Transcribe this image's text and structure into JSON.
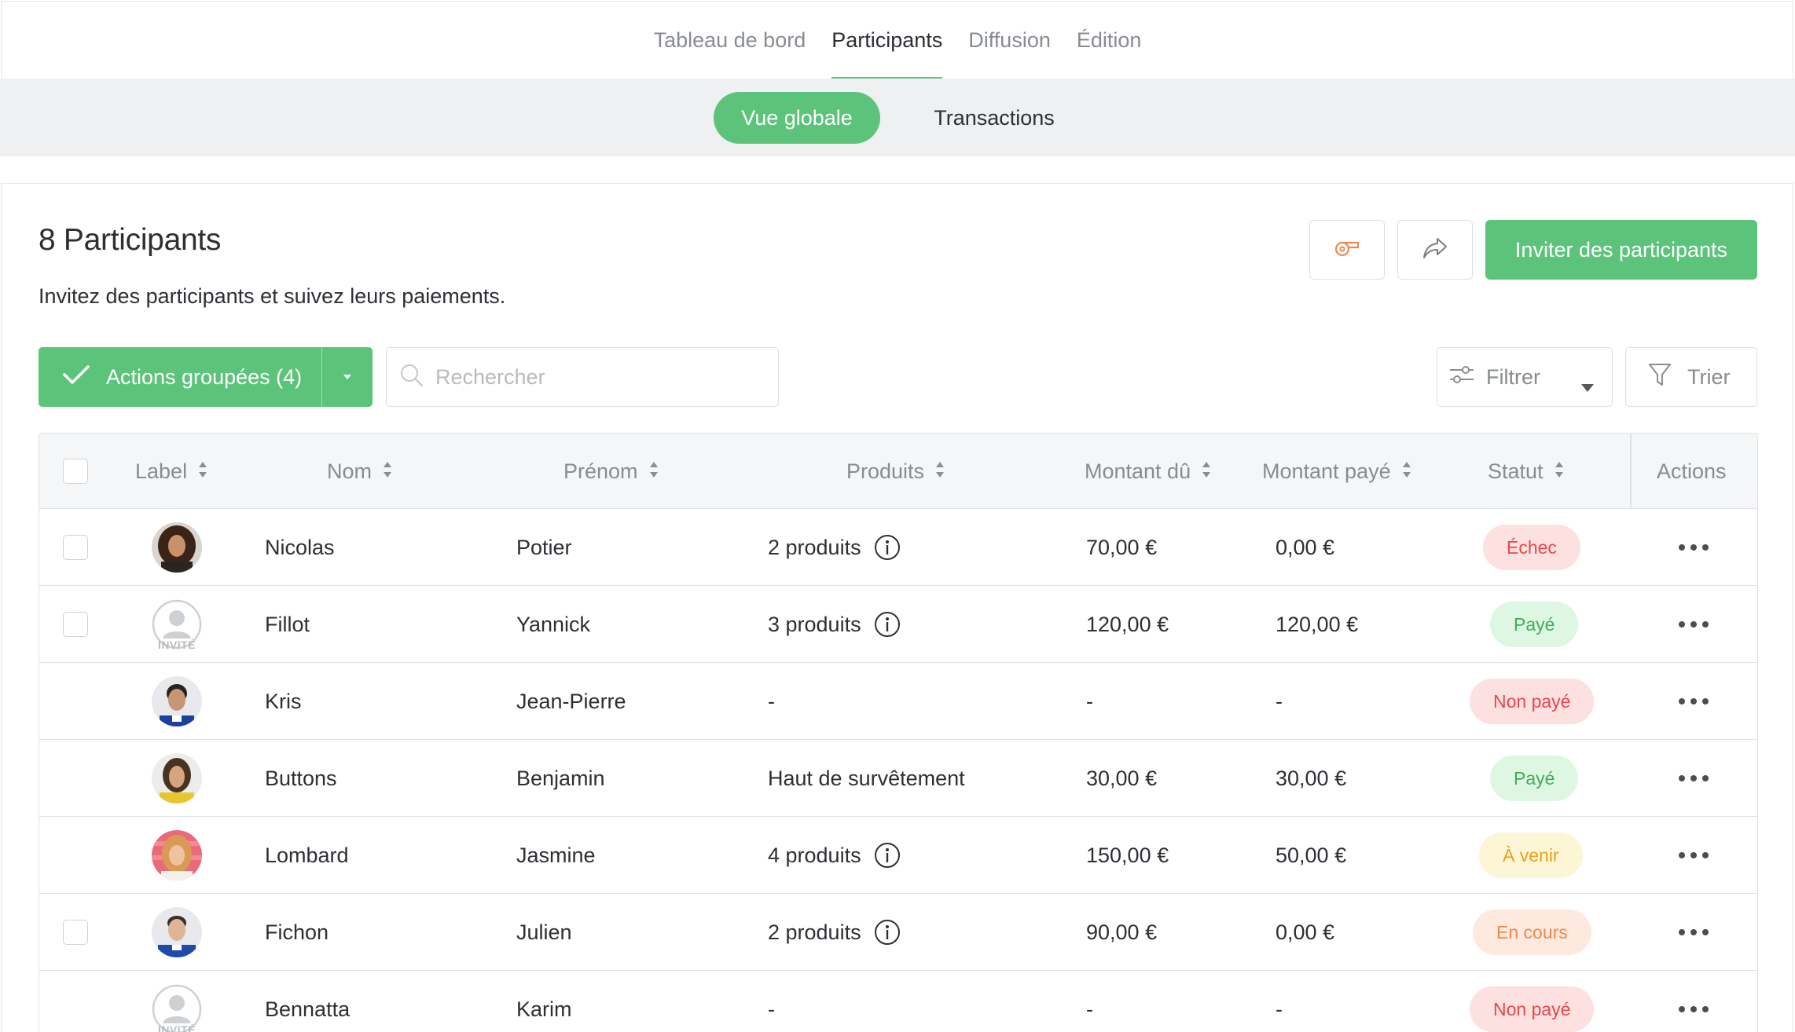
{
  "topnav": {
    "tabs": [
      {
        "label": "Tableau de bord",
        "active": false
      },
      {
        "label": "Participants",
        "active": true
      },
      {
        "label": "Diffusion",
        "active": false
      },
      {
        "label": "Édition",
        "active": false
      }
    ]
  },
  "subnav": {
    "pills": [
      {
        "label": "Vue globale",
        "active": true
      },
      {
        "label": "Transactions",
        "active": false
      }
    ]
  },
  "header": {
    "title": "8 Participants",
    "subtitle": "Invitez des participants et suivez leurs paiements.",
    "whistle_icon": "whistle-icon",
    "share_icon": "share-icon",
    "invite_label": "Inviter des participants"
  },
  "toolbar": {
    "bulk_label": "Actions groupées (4)",
    "search_placeholder": "Rechercher",
    "filter_label": "Filtrer",
    "sort_label": "Trier"
  },
  "table": {
    "columns": {
      "label": "Label",
      "nom": "Nom",
      "prenom": "Prénom",
      "produits": "Produits",
      "montant_du": "Montant dû",
      "montant_paye": "Montant payé",
      "statut": "Statut",
      "actions": "Actions"
    },
    "guest_text": "INVITÉ",
    "rows": [
      {
        "has_checkbox": true,
        "avatar": "photo-long-curly-hair",
        "nom": "Nicolas",
        "prenom": "Potier",
        "produits": "2 produits",
        "has_info": true,
        "montant_du": "70,00 €",
        "montant_paye": "0,00 €",
        "statut": "Échec",
        "statut_kind": "echec"
      },
      {
        "has_checkbox": true,
        "avatar": "guest-placeholder",
        "nom": "Fillot",
        "prenom": "Yannick",
        "produits": "3 produits",
        "has_info": true,
        "montant_du": "120,00 €",
        "montant_paye": "120,00 €",
        "statut": "Payé",
        "statut_kind": "paye"
      },
      {
        "has_checkbox": false,
        "avatar": "photo-short-dark-hair",
        "nom": "Kris",
        "prenom": "Jean-Pierre",
        "produits": "-",
        "has_info": false,
        "montant_du": "-",
        "montant_paye": "-",
        "statut": "Non payé",
        "statut_kind": "nonpaye"
      },
      {
        "has_checkbox": false,
        "avatar": "photo-long-hair-yellow-shirt",
        "nom": "Buttons",
        "prenom": "Benjamin",
        "produits": "Haut de survêtement",
        "has_info": false,
        "montant_du": "30,00 €",
        "montant_paye": "30,00 €",
        "statut": "Payé",
        "statut_kind": "paye"
      },
      {
        "has_checkbox": false,
        "avatar": "photo-blonde-pink-background",
        "nom": "Lombard",
        "prenom": "Jasmine",
        "produits": "4 produits",
        "has_info": true,
        "montant_du": "150,00 €",
        "montant_paye": "50,00 €",
        "statut": "À venir",
        "statut_kind": "avenir"
      },
      {
        "has_checkbox": true,
        "avatar": "photo-short-hair-blue-shirt",
        "nom": "Fichon",
        "prenom": "Julien",
        "produits": "2 produits",
        "has_info": true,
        "montant_du": "90,00 €",
        "montant_paye": "0,00 €",
        "statut": "En cours",
        "statut_kind": "encours"
      },
      {
        "has_checkbox": false,
        "avatar": "guest-placeholder",
        "nom": "Bennatta",
        "prenom": "Karim",
        "produits": "-",
        "has_info": false,
        "montant_du": "-",
        "montant_paye": "-",
        "statut": "Non payé",
        "statut_kind": "nonpaye"
      }
    ]
  },
  "colors": {
    "accent": "#5cc37a",
    "text": "#2c2f33",
    "muted": "#888c90",
    "border": "#e0e2e5",
    "header_bg": "#f5f6f7",
    "subnav_bg": "#eef0f1"
  }
}
